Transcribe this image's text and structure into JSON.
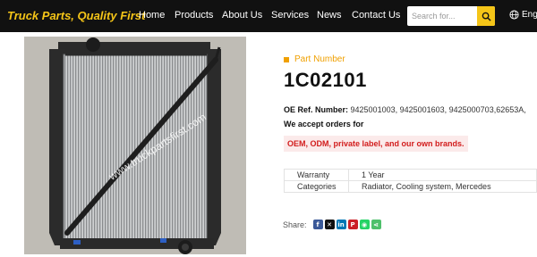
{
  "header": {
    "brand": "Truck Parts, Quality First",
    "nav": [
      "Home",
      "Products",
      "About Us",
      "Services",
      "News",
      "Contact Us"
    ],
    "search_placeholder": "Search for...",
    "language": "Eng"
  },
  "product": {
    "image_watermark": "www.truckpartsfirst.com",
    "part_number_label": "Part Number",
    "part_number": "1C02101",
    "oe_label": "OE Ref. Number:",
    "oe_numbers": "9425001003, 9425001603, 9425000703,62653A,",
    "accept_text": "We accept orders for",
    "highlight_text": "OEM, ODM, private label, and our own brands.",
    "specs": [
      {
        "key": "Warranty",
        "value": "1 Year"
      },
      {
        "key": "Categories",
        "value": "Radiator, Cooling system, Mercedes"
      }
    ],
    "share_label": "Share:"
  },
  "colors": {
    "accent": "#f5c518",
    "nav_bg": "#111111",
    "highlight_red": "#d21c1c",
    "facebook": "#3b5998",
    "x": "#111111",
    "linkedin": "#0077b5",
    "pinterest": "#cb2027",
    "whatsapp": "#25d366",
    "sharethis": "#4ec06b"
  },
  "share_icons": [
    "facebook-icon",
    "x-icon",
    "linkedin-icon",
    "pinterest-icon",
    "whatsapp-icon",
    "share-icon"
  ]
}
